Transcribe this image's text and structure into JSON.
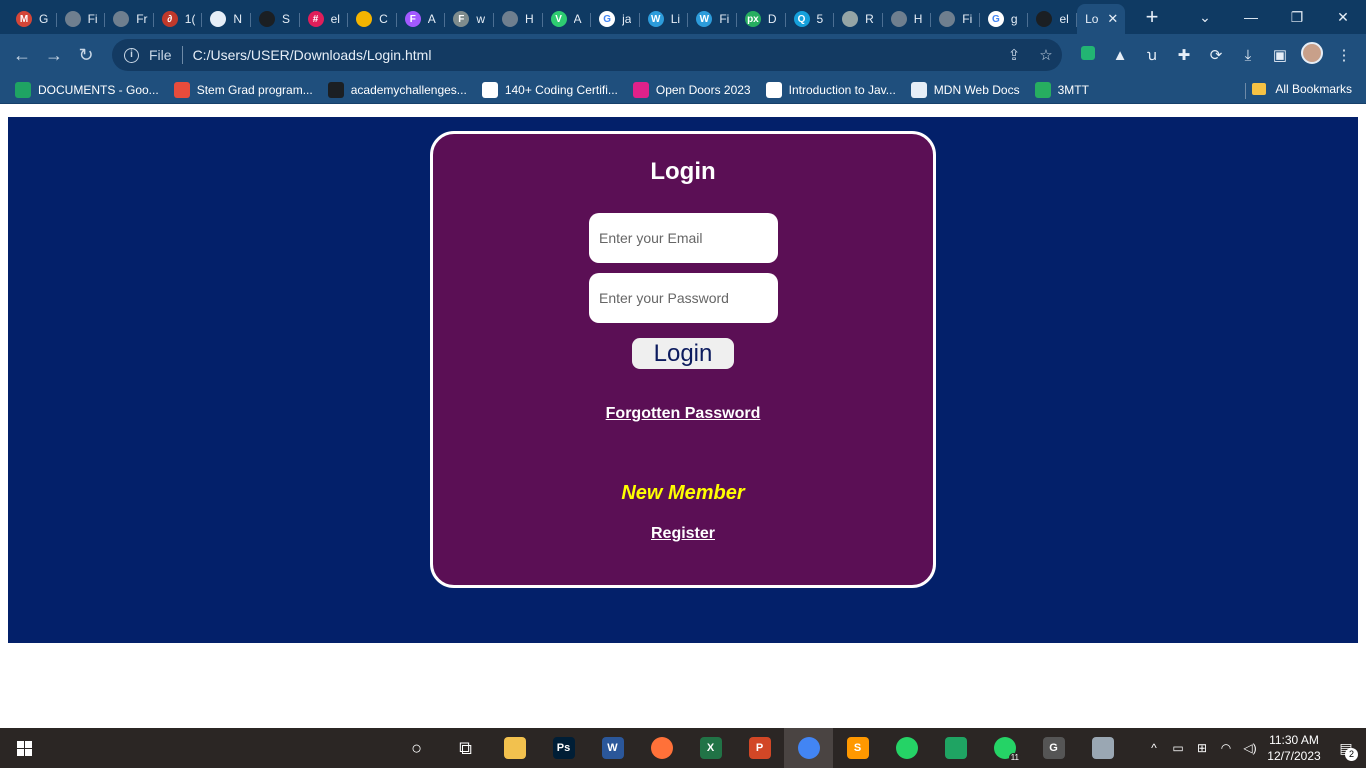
{
  "browser": {
    "tabs": [
      {
        "title": "G",
        "icon": "gmail-icon",
        "color": "#d44638",
        "glyph": "M"
      },
      {
        "title": "Fi",
        "icon": "globe-icon",
        "color": "#6f7f8f",
        "glyph": ""
      },
      {
        "title": "Fr",
        "icon": "globe-icon",
        "color": "#6f7f8f",
        "glyph": ""
      },
      {
        "title": "1(",
        "icon": "link-icon",
        "color": "#c0392b",
        "glyph": "∂"
      },
      {
        "title": "N",
        "icon": "chrome-icon",
        "color": "#e6eef7",
        "glyph": ""
      },
      {
        "title": "S",
        "icon": "github-icon",
        "color": "#1b1f23",
        "glyph": ""
      },
      {
        "title": "el",
        "icon": "slack-icon",
        "color": "#e01e5a",
        "glyph": "#"
      },
      {
        "title": "C",
        "icon": "slides-icon",
        "color": "#f4b400",
        "glyph": ""
      },
      {
        "title": "A",
        "icon": "figma-icon",
        "color": "#a259ff",
        "glyph": "F"
      },
      {
        "title": "w",
        "icon": "figma-icon",
        "color": "#7f8c8d",
        "glyph": "F"
      },
      {
        "title": "H",
        "icon": "globe-icon",
        "color": "#6f7f8f",
        "glyph": ""
      },
      {
        "title": "A",
        "icon": "vuetify-icon",
        "color": "#2ecc71",
        "glyph": "V"
      },
      {
        "title": "ja",
        "icon": "google-icon",
        "color": "#ffffff",
        "glyph": "G"
      },
      {
        "title": "Li",
        "icon": "webflow-icon",
        "color": "#2d9cdb",
        "glyph": "W"
      },
      {
        "title": "Fi",
        "icon": "webflow-icon",
        "color": "#2d9cdb",
        "glyph": "W"
      },
      {
        "title": "D",
        "icon": "pixel-icon",
        "color": "#27ae60",
        "glyph": "px"
      },
      {
        "title": "5",
        "icon": "search-icon",
        "color": "#16a0db",
        "glyph": "Q"
      },
      {
        "title": "R",
        "icon": "books-icon",
        "color": "#95a5a6",
        "glyph": ""
      },
      {
        "title": "H",
        "icon": "globe-icon",
        "color": "#6f7f8f",
        "glyph": ""
      },
      {
        "title": "Fi",
        "icon": "globe-icon",
        "color": "#6f7f8f",
        "glyph": ""
      },
      {
        "title": "g",
        "icon": "google-icon",
        "color": "#ffffff",
        "glyph": "G"
      },
      {
        "title": "el",
        "icon": "github-icon",
        "color": "#1b1f23",
        "glyph": ""
      }
    ],
    "active_tab": {
      "title": "Lo"
    },
    "address": {
      "scheme": "File",
      "url": "C:/Users/USER/Downloads/Login.html"
    },
    "bookmarks": [
      {
        "label": "DOCUMENTS - Goo...",
        "icon": "drive-icon",
        "color": "#1fa463"
      },
      {
        "label": "Stem Grad program...",
        "icon": "stack-icon",
        "color": "#e74c3c"
      },
      {
        "label": "academychallenges...",
        "icon": "github-icon",
        "color": "#1b1f23"
      },
      {
        "label": "140+ Coding Certifi...",
        "icon": "notion-icon",
        "color": "#ffffff"
      },
      {
        "label": "Open Doors 2023",
        "icon": "od-icon",
        "color": "#e0218a"
      },
      {
        "label": "Introduction to Jav...",
        "icon": "google-icon",
        "color": "#ffffff"
      },
      {
        "label": "MDN Web Docs",
        "icon": "globe-icon",
        "color": "#e6eef7"
      },
      {
        "label": "3MTT",
        "icon": "3mtt-icon",
        "color": "#27ae60"
      }
    ],
    "all_bookmarks_label": "All Bookmarks"
  },
  "login": {
    "title": "Login",
    "email_placeholder": "Enter your Email",
    "password_placeholder": "Enter your Password",
    "button_label": "Login",
    "forgot_label": "Forgotten Password",
    "new_member_label": "New Member",
    "register_label": "Register"
  },
  "colors": {
    "page_background": "#03206a",
    "card_background": "#5b0f55",
    "new_member_text": "#ffff00"
  },
  "taskbar": {
    "apps": [
      {
        "name": "cortana-icon",
        "glyph": "○",
        "color": "transparent"
      },
      {
        "name": "task-view-icon",
        "glyph": "⧉",
        "color": "transparent"
      },
      {
        "name": "file-explorer-icon",
        "glyph": "",
        "color": "#f2c14e"
      },
      {
        "name": "photoshop-icon",
        "glyph": "Ps",
        "color": "#001e36"
      },
      {
        "name": "word-icon",
        "glyph": "W",
        "color": "#2b579a"
      },
      {
        "name": "firefox-icon",
        "glyph": "",
        "color": "#ff7139"
      },
      {
        "name": "excel-icon",
        "glyph": "X",
        "color": "#217346"
      },
      {
        "name": "powerpoint-icon",
        "glyph": "P",
        "color": "#d24726"
      },
      {
        "name": "chrome-icon",
        "glyph": "",
        "color": "#4285f4"
      },
      {
        "name": "sublime-icon",
        "glyph": "S",
        "color": "#ff9800"
      },
      {
        "name": "whatsapp-icon",
        "glyph": "",
        "color": "#25d366"
      },
      {
        "name": "drive-icon",
        "glyph": "",
        "color": "#1fa463"
      },
      {
        "name": "whatsapp-icon",
        "glyph": "",
        "color": "#25d366",
        "badge": "11"
      },
      {
        "name": "gcloud-icon",
        "glyph": "G",
        "color": "#555555"
      },
      {
        "name": "photos-icon",
        "glyph": "",
        "color": "#9aa7b3"
      }
    ],
    "time": "11:30 AM",
    "date": "12/7/2023",
    "notifications": "2"
  }
}
